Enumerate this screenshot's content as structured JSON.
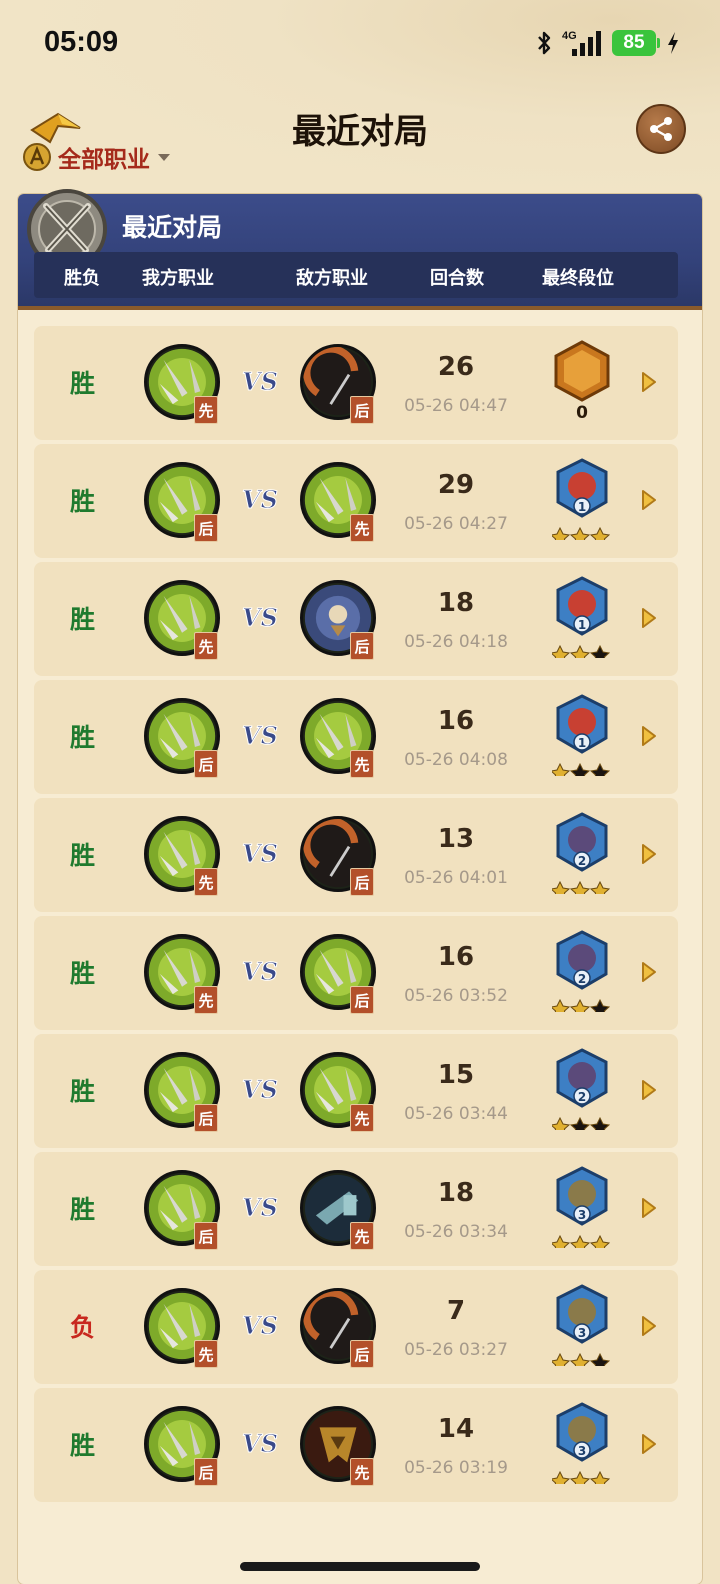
{
  "status_bar": {
    "time": "05:09",
    "network": "4G",
    "battery": "85"
  },
  "header": {
    "title": "最近对局",
    "class_filter": "全部职业"
  },
  "panel": {
    "title": "最近对局",
    "columns": [
      "胜负",
      "我方职业",
      "敌方职业",
      "回合数",
      "最终段位"
    ]
  },
  "vs_label": "VS",
  "matches": [
    {
      "result": "胜",
      "outcome": "win",
      "my_class": "demon-hunter",
      "my_order": "先",
      "enemy_class": "rogue",
      "enemy_order": "后",
      "turns": "26",
      "time": "05-26 04:47",
      "rank": "legend",
      "rank_value": "0",
      "stars": 0
    },
    {
      "result": "胜",
      "outcome": "win",
      "my_class": "demon-hunter",
      "my_order": "后",
      "enemy_class": "demon-hunter",
      "enemy_order": "先",
      "turns": "29",
      "time": "05-26 04:27",
      "rank": "diamond",
      "rank_value": "1",
      "stars": 3
    },
    {
      "result": "胜",
      "outcome": "win",
      "my_class": "demon-hunter",
      "my_order": "先",
      "enemy_class": "death-knight",
      "enemy_order": "后",
      "turns": "18",
      "time": "05-26 04:18",
      "rank": "diamond",
      "rank_value": "1",
      "stars": 2
    },
    {
      "result": "胜",
      "outcome": "win",
      "my_class": "demon-hunter",
      "my_order": "后",
      "enemy_class": "demon-hunter",
      "enemy_order": "先",
      "turns": "16",
      "time": "05-26 04:08",
      "rank": "diamond",
      "rank_value": "1",
      "stars": 1
    },
    {
      "result": "胜",
      "outcome": "win",
      "my_class": "demon-hunter",
      "my_order": "先",
      "enemy_class": "rogue",
      "enemy_order": "后",
      "turns": "13",
      "time": "05-26 04:01",
      "rank": "diamond",
      "rank_value": "2",
      "stars": 3
    },
    {
      "result": "胜",
      "outcome": "win",
      "my_class": "demon-hunter",
      "my_order": "先",
      "enemy_class": "demon-hunter",
      "enemy_order": "后",
      "turns": "16",
      "time": "05-26 03:52",
      "rank": "diamond",
      "rank_value": "2",
      "stars": 2
    },
    {
      "result": "胜",
      "outcome": "win",
      "my_class": "demon-hunter",
      "my_order": "后",
      "enemy_class": "demon-hunter",
      "enemy_order": "先",
      "turns": "15",
      "time": "05-26 03:44",
      "rank": "diamond",
      "rank_value": "2",
      "stars": 1
    },
    {
      "result": "胜",
      "outcome": "win",
      "my_class": "demon-hunter",
      "my_order": "后",
      "enemy_class": "paladin",
      "enemy_order": "先",
      "turns": "18",
      "time": "05-26 03:34",
      "rank": "diamond",
      "rank_value": "3",
      "stars": 3
    },
    {
      "result": "负",
      "outcome": "lose",
      "my_class": "demon-hunter",
      "my_order": "先",
      "enemy_class": "rogue",
      "enemy_order": "后",
      "turns": "7",
      "time": "05-26 03:27",
      "rank": "diamond",
      "rank_value": "3",
      "stars": 2
    },
    {
      "result": "胜",
      "outcome": "win",
      "my_class": "demon-hunter",
      "my_order": "后",
      "enemy_class": "warrior",
      "enemy_order": "先",
      "turns": "14",
      "time": "05-26 03:19",
      "rank": "diamond",
      "rank_value": "3",
      "stars": 3
    }
  ],
  "colors": {
    "win": "#1f7a2e",
    "lose": "#c8281e",
    "header_blue": "#33427a",
    "filter_red": "#a52a1b"
  }
}
